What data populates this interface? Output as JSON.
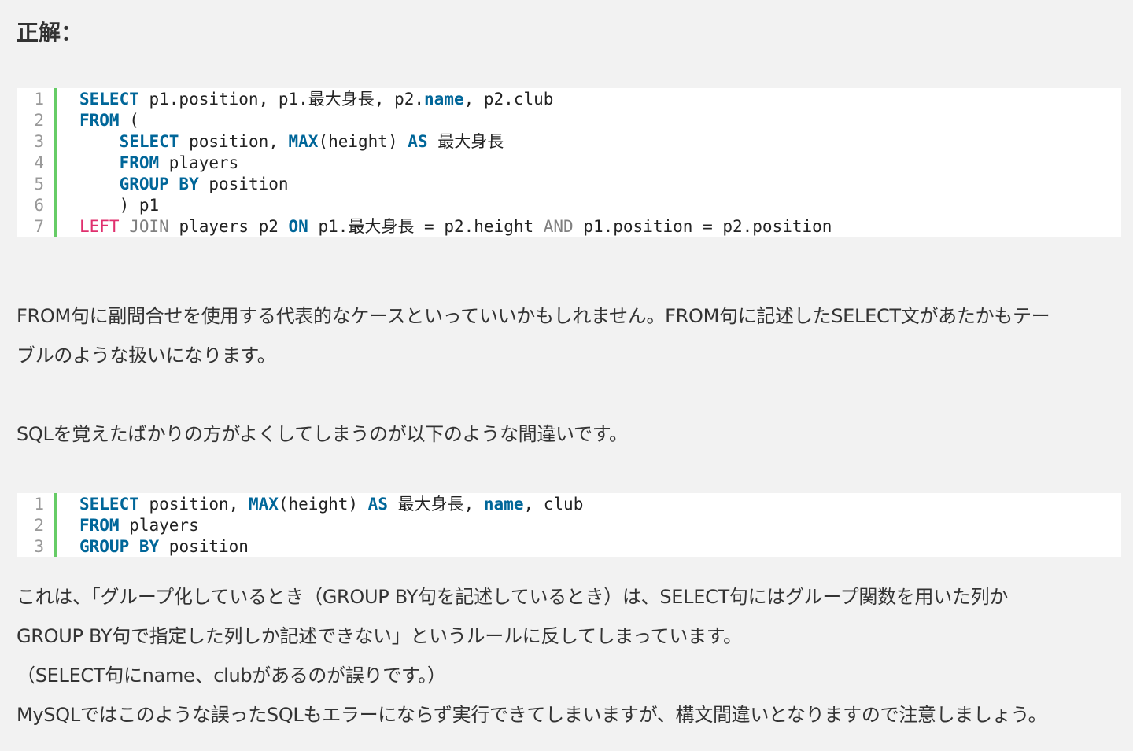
{
  "heading": "正解：",
  "code_block_1": {
    "line_numbers": [
      "1",
      "2",
      "3",
      "4",
      "5",
      "6",
      "7"
    ],
    "lines": [
      [
        {
          "t": "SELECT",
          "c": "kw"
        },
        {
          "t": " p1.position, p1.最大身長, p2.",
          "c": "plain"
        },
        {
          "t": "name",
          "c": "kw"
        },
        {
          "t": ", p2.club",
          "c": "plain"
        }
      ],
      [
        {
          "t": "FROM",
          "c": "kw"
        },
        {
          "t": " (",
          "c": "plain"
        }
      ],
      [
        {
          "t": "    ",
          "c": "plain"
        },
        {
          "t": "SELECT",
          "c": "kw"
        },
        {
          "t": " position, ",
          "c": "plain"
        },
        {
          "t": "MAX",
          "c": "kw"
        },
        {
          "t": "(height) ",
          "c": "plain"
        },
        {
          "t": "AS",
          "c": "kw"
        },
        {
          "t": " 最大身長",
          "c": "plain"
        }
      ],
      [
        {
          "t": "    ",
          "c": "plain"
        },
        {
          "t": "FROM",
          "c": "kw"
        },
        {
          "t": " players",
          "c": "plain"
        }
      ],
      [
        {
          "t": "    ",
          "c": "plain"
        },
        {
          "t": "GROUP BY",
          "c": "kw"
        },
        {
          "t": " position",
          "c": "plain"
        }
      ],
      [
        {
          "t": "    ) p1",
          "c": "plain"
        }
      ],
      [
        {
          "t": "LEFT",
          "c": "kw-pink"
        },
        {
          "t": " ",
          "c": "plain"
        },
        {
          "t": "JOIN",
          "c": "kw-gray"
        },
        {
          "t": " players p2 ",
          "c": "plain"
        },
        {
          "t": "ON",
          "c": "kw"
        },
        {
          "t": " p1.最大身長 = p2.height ",
          "c": "plain"
        },
        {
          "t": "AND",
          "c": "kw-gray"
        },
        {
          "t": " p1.position = p2.position",
          "c": "plain"
        }
      ]
    ]
  },
  "paragraph_1": {
    "lines": [
      "FROM句に副問合せを使用する代表的なケースといっていいかもしれません。FROM句に記述したSELECT文があたかもテー",
      "ブルのような扱いになります。"
    ]
  },
  "paragraph_2": {
    "lines": [
      "SQLを覚えたばかりの方がよくしてしまうのが以下のような間違いです。"
    ]
  },
  "code_block_2": {
    "line_numbers": [
      "1",
      "2",
      "3"
    ],
    "lines": [
      [
        {
          "t": "SELECT",
          "c": "kw"
        },
        {
          "t": " position, ",
          "c": "plain"
        },
        {
          "t": "MAX",
          "c": "kw"
        },
        {
          "t": "(height) ",
          "c": "plain"
        },
        {
          "t": "AS",
          "c": "kw"
        },
        {
          "t": " 最大身長, ",
          "c": "plain"
        },
        {
          "t": "name",
          "c": "kw"
        },
        {
          "t": ", club",
          "c": "plain"
        }
      ],
      [
        {
          "t": "FROM",
          "c": "kw"
        },
        {
          "t": " players",
          "c": "plain"
        }
      ],
      [
        {
          "t": "GROUP BY",
          "c": "kw"
        },
        {
          "t": " position",
          "c": "plain"
        }
      ]
    ]
  },
  "paragraph_3": {
    "lines": [
      "これは、「グループ化しているとき（GROUP BY句を記述しているとき）は、SELECT句にはグループ関数を用いた列か",
      "GROUP BY句で指定した列しか記述できない」というルールに反してしまっています。",
      "（SELECT句にname、clubがあるのが誤りです。）",
      "MySQLではこのような誤ったSQLもエラーにならず実行できてしまいますが、構文間違いとなりますので注意しましょう。"
    ]
  }
}
